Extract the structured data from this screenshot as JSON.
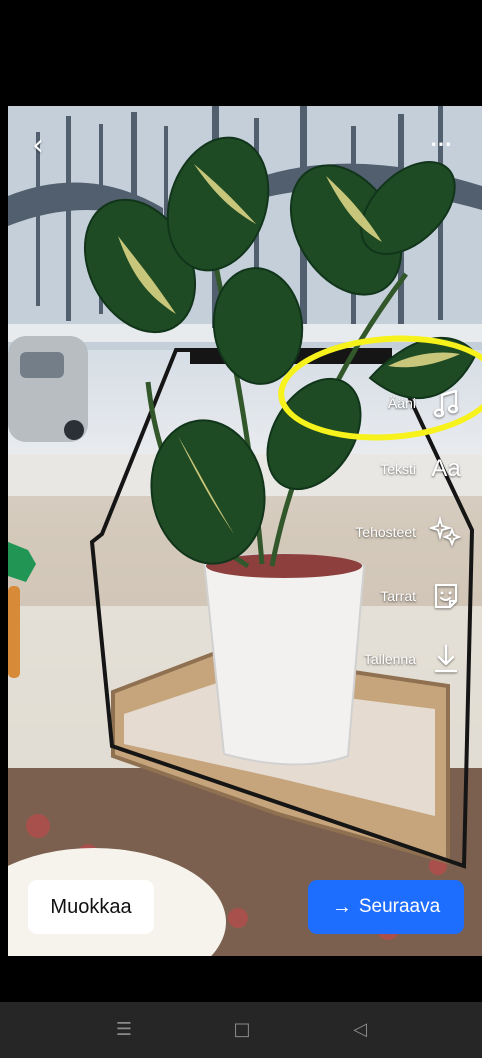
{
  "topbar": {
    "back_icon": "chevron-left-icon",
    "more_icon": "more-horizontal-icon"
  },
  "tools": [
    {
      "label": "Ääni",
      "icon": "music-note-icon"
    },
    {
      "label": "Teksti",
      "icon": "text-aa-icon"
    },
    {
      "label": "Tehosteet",
      "icon": "sparkles-icon"
    },
    {
      "label": "Tarrat",
      "icon": "sticker-face-icon"
    },
    {
      "label": "Tallenna",
      "icon": "download-icon"
    }
  ],
  "text_icon_glyph": "Aa",
  "bottom": {
    "edit_label": "Muokkaa",
    "next_label": "Seuraava",
    "next_arrow": "→"
  },
  "navigation": {
    "menu_icon": "menu-icon",
    "home_icon": "home-square-icon",
    "back_icon": "back-triangle-icon",
    "menu_glyph": "☰",
    "home_glyph": "□",
    "back_glyph": "◁"
  },
  "colors": {
    "primary_blue": "#1d6dff",
    "highlight_yellow": "#f7f21b",
    "white": "#ffffff",
    "black": "#000000"
  }
}
